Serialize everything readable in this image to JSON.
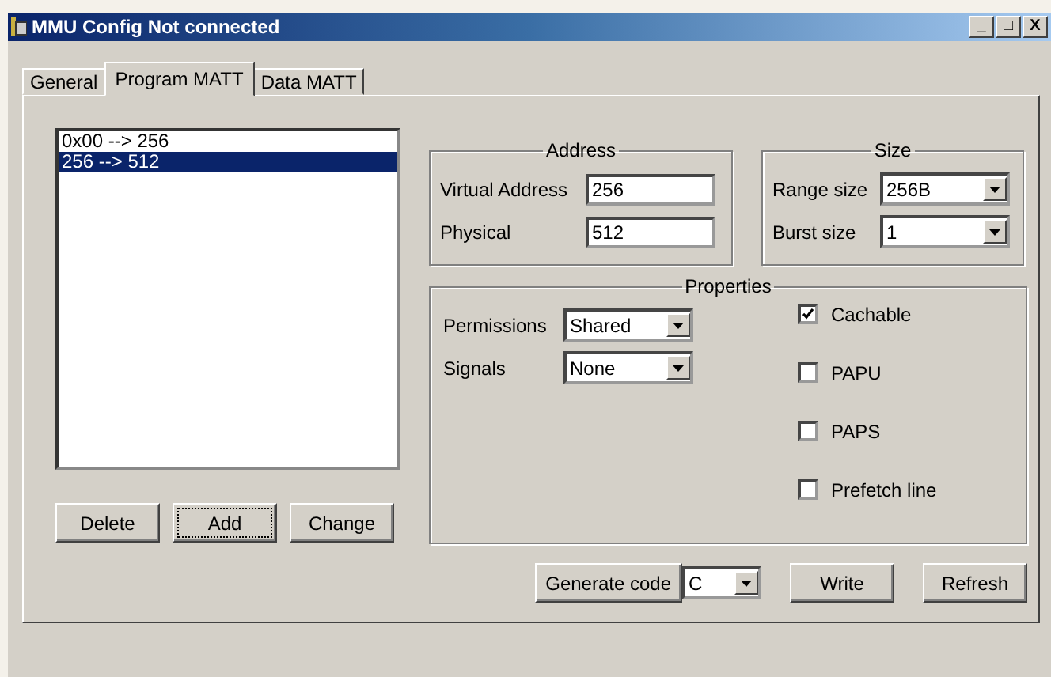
{
  "window": {
    "title": "MMU Config Not connected",
    "controls": [
      "_",
      "□",
      "X"
    ]
  },
  "tabs": [
    {
      "label": "General",
      "selected": false
    },
    {
      "label": "Program MATT",
      "selected": true
    },
    {
      "label": "Data MATT",
      "selected": false
    }
  ],
  "list": {
    "items": [
      {
        "label": "0x00 --> 256",
        "selected": false
      },
      {
        "label": "256 --> 512",
        "selected": true
      }
    ]
  },
  "list_buttons": [
    {
      "label": "Delete",
      "focused": false
    },
    {
      "label": "Add",
      "focused": true
    },
    {
      "label": "Change",
      "focused": false
    }
  ],
  "address": {
    "title": "Address",
    "fields": [
      {
        "label": "Virtual Address",
        "value": "256"
      },
      {
        "label": "Physical",
        "value": "512"
      }
    ]
  },
  "size": {
    "title": "Size",
    "fields": [
      {
        "label": "Range size",
        "value": "256B"
      },
      {
        "label": "Burst size",
        "value": "1"
      }
    ]
  },
  "properties": {
    "title": "Properties",
    "combos": [
      {
        "label": "Permissions",
        "value": "Shared"
      },
      {
        "label": "Signals",
        "value": "None"
      }
    ],
    "checkboxes": [
      {
        "label": "Cachable",
        "checked": true
      },
      {
        "label": "PAPU",
        "checked": false
      },
      {
        "label": "PAPS",
        "checked": false
      },
      {
        "label": "Prefetch line",
        "checked": false
      }
    ]
  },
  "generate": {
    "label": "Generate code",
    "language": "C"
  },
  "buttons": [
    "Write",
    "Refresh"
  ]
}
